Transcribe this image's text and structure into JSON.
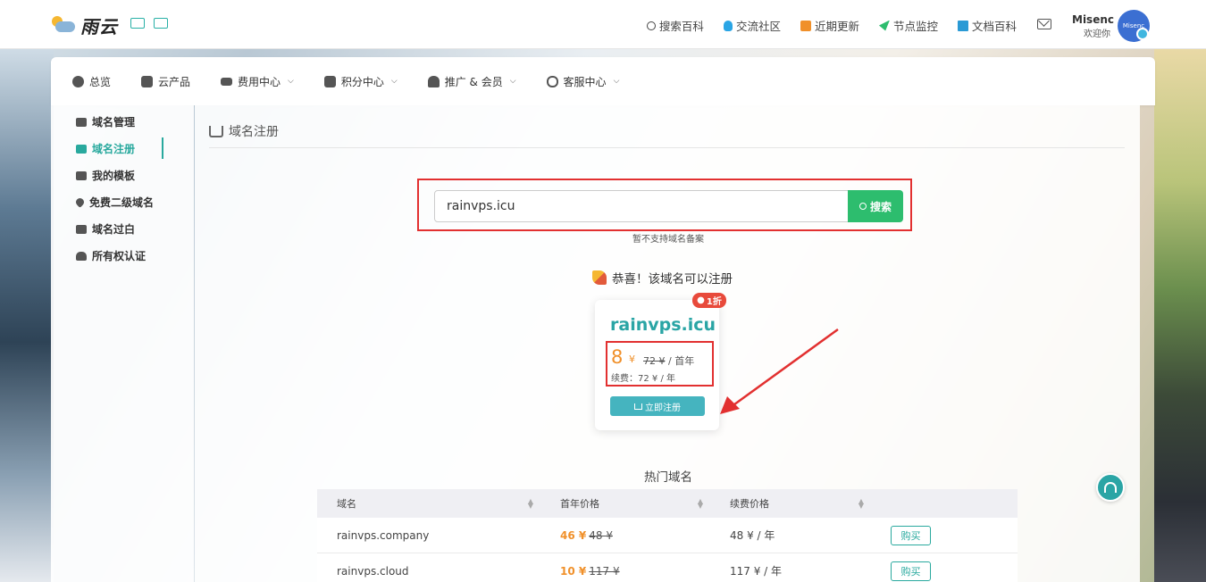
{
  "brand": {
    "name": "雨云"
  },
  "topnav": {
    "items": [
      {
        "label": "搜索百科",
        "icon": "search-icon"
      },
      {
        "label": "交流社区",
        "icon": "qq-icon"
      },
      {
        "label": "近期更新",
        "icon": "book-icon"
      },
      {
        "label": "节点监控",
        "icon": "send-icon"
      },
      {
        "label": "文档百科",
        "icon": "open-book-icon"
      }
    ]
  },
  "user": {
    "name": "Misenc",
    "greeting": "欢迎你",
    "avatar_text": "Misenc"
  },
  "mainnav": {
    "items": [
      {
        "label": "总览",
        "icon": "dashboard-icon",
        "dropdown": false
      },
      {
        "label": "云产品",
        "icon": "cubes-icon",
        "dropdown": false
      },
      {
        "label": "费用中心",
        "icon": "money-icon",
        "dropdown": true
      },
      {
        "label": "积分中心",
        "icon": "gift-icon",
        "dropdown": true
      },
      {
        "label": "推广 & 会员",
        "icon": "users-icon",
        "dropdown": true
      },
      {
        "label": "客服中心",
        "icon": "headset-icon",
        "dropdown": true
      }
    ]
  },
  "sidebar": {
    "items": [
      {
        "label": "域名管理",
        "icon": "cogs-icon",
        "active": false
      },
      {
        "label": "域名注册",
        "icon": "cart-icon",
        "active": true
      },
      {
        "label": "我的模板",
        "icon": "id-card-icon",
        "active": false
      },
      {
        "label": "免费二级域名",
        "icon": "heart-icon",
        "active": false
      },
      {
        "label": "域名过白",
        "icon": "inbox-icon",
        "active": false
      },
      {
        "label": "所有权认证",
        "icon": "user-check-icon",
        "active": false
      }
    ]
  },
  "page": {
    "title": "域名注册"
  },
  "search": {
    "value": "rainvps.icu",
    "button_label": "搜索",
    "hint": "暂不支持域名备案"
  },
  "result": {
    "message": "恭喜！该域名可以注册",
    "discount_tag": "1折",
    "domain": "rainvps.icu",
    "price_now": "8",
    "currency": "¥",
    "price_old": "72 ¥",
    "price_old_suffix": "/ 首年",
    "renew": "续费：72 ¥ / 年",
    "register_label": "立即注册"
  },
  "hot": {
    "title": "热门域名",
    "columns": [
      "域名",
      "首年价格",
      "续费价格",
      ""
    ],
    "rows": [
      {
        "domain": "rainvps.company",
        "price_now": "46 ¥",
        "price_old": "48 ¥",
        "renew": "48 ¥ / 年",
        "action": "购买"
      },
      {
        "domain": "rainvps.cloud",
        "price_now": "10 ¥",
        "price_old": "117 ¥",
        "renew": "117 ¥ / 年",
        "action": "购买"
      }
    ]
  },
  "colors": {
    "accent": "#29a99e",
    "search_btn": "#2dbd6e",
    "price": "#f0902a",
    "highlight_box": "#e23030"
  }
}
